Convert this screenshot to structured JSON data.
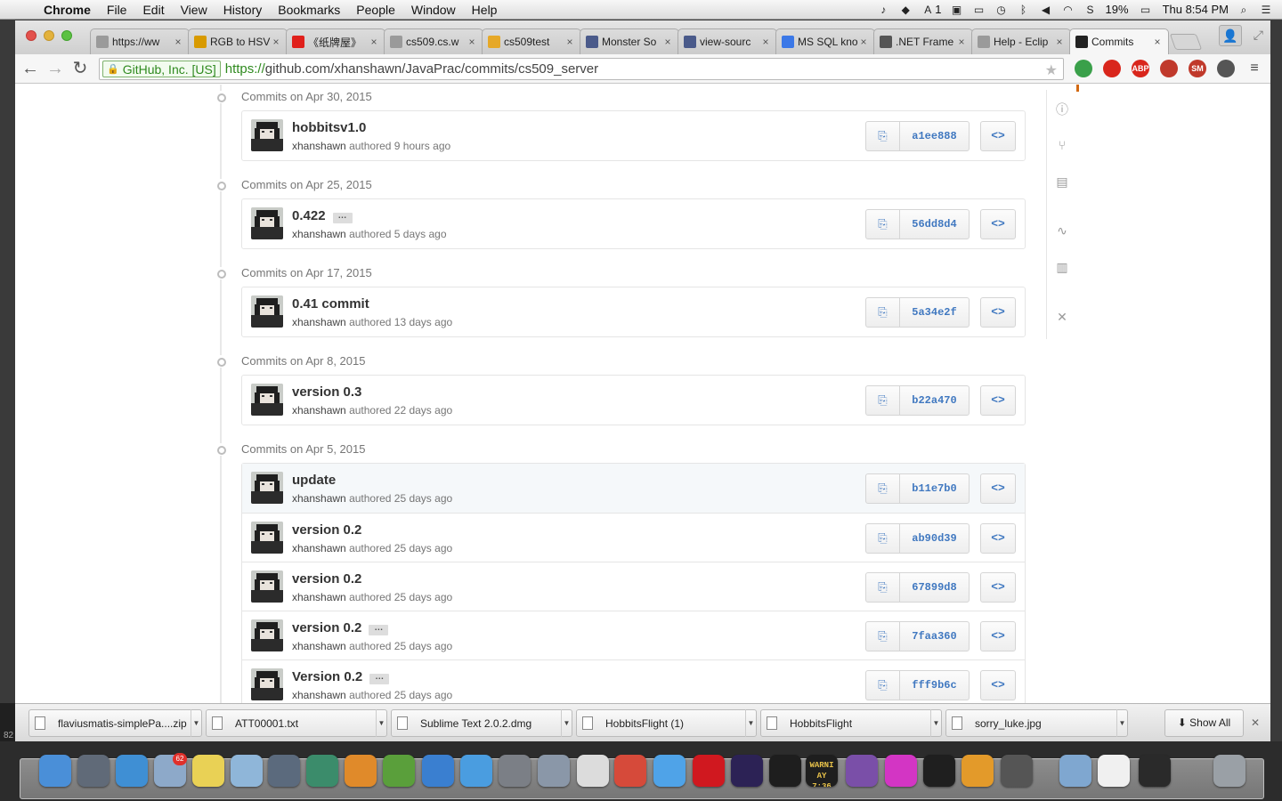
{
  "menubar": {
    "app": "Chrome",
    "items": [
      "File",
      "Edit",
      "View",
      "History",
      "Bookmarks",
      "People",
      "Window",
      "Help"
    ],
    "ai_count": "1",
    "battery": "19%",
    "clock": "Thu 8:54 PM"
  },
  "tabs": [
    {
      "title": "https://ww",
      "icon": "page-icon",
      "color": "#9a9a9a"
    },
    {
      "title": "RGB to HSV",
      "icon": "r-logo-icon",
      "color": "#d89a00"
    },
    {
      "title": "《纸牌屋》",
      "icon": "video-icon",
      "color": "#e0201b"
    },
    {
      "title": "cs509.cs.w",
      "icon": "page-icon",
      "color": "#9a9a9a"
    },
    {
      "title": "cs509test",
      "icon": "box-icon",
      "color": "#e6a828"
    },
    {
      "title": "Monster So",
      "icon": "hackerrank-icon",
      "color": "#4a5a8a"
    },
    {
      "title": "view-sourc",
      "icon": "hackerrank-icon",
      "color": "#4a5a8a"
    },
    {
      "title": "MS SQL kno",
      "icon": "google-icon",
      "color": "#3b78e7"
    },
    {
      "title": ".NET Frame",
      "icon": "wikipedia-icon",
      "color": "#555555"
    },
    {
      "title": "Help - Eclip",
      "icon": "page-icon",
      "color": "#9a9a9a"
    },
    {
      "title": "Commits",
      "icon": "github-icon",
      "color": "#222222"
    }
  ],
  "address": {
    "ev_name": "GitHub, Inc. [US]",
    "scheme": "https://",
    "url_rest": "github.com/xhanshawn/JavaPrac/commits/cs509_server"
  },
  "extensions": [
    {
      "name": "color-wheel-icon",
      "label": "",
      "color": "#3aa04a"
    },
    {
      "name": "stop-icon",
      "label": "",
      "color": "#d9261c"
    },
    {
      "name": "adblock-icon",
      "label": "ABP",
      "color": "#d9261c"
    },
    {
      "name": "book-icon",
      "label": "",
      "color": "#c0392b"
    },
    {
      "name": "sm-icon",
      "label": "SM",
      "color": "#c0392b"
    },
    {
      "name": "ball-icon",
      "label": "",
      "color": "#555555"
    },
    {
      "name": "menu-icon",
      "label": "",
      "color": "#777777"
    }
  ],
  "commit_days": [
    {
      "date": "Commits on Apr 30, 2015",
      "commits": [
        {
          "message": "hobbitsv1.0",
          "author": "xhanshawn",
          "verb": "authored",
          "time": "9 hours ago",
          "sha": "a1ee888",
          "ellipsis": false,
          "highlight": false
        }
      ]
    },
    {
      "date": "Commits on Apr 25, 2015",
      "commits": [
        {
          "message": "0.422",
          "author": "xhanshawn",
          "verb": "authored",
          "time": "5 days ago",
          "sha": "56dd8d4",
          "ellipsis": true,
          "highlight": false
        }
      ]
    },
    {
      "date": "Commits on Apr 17, 2015",
      "commits": [
        {
          "message": "0.41 commit",
          "author": "xhanshawn",
          "verb": "authored",
          "time": "13 days ago",
          "sha": "5a34e2f",
          "ellipsis": false,
          "highlight": false
        }
      ]
    },
    {
      "date": "Commits on Apr 8, 2015",
      "commits": [
        {
          "message": "version 0.3",
          "author": "xhanshawn",
          "verb": "authored",
          "time": "22 days ago",
          "sha": "b22a470",
          "ellipsis": false,
          "highlight": false
        }
      ]
    },
    {
      "date": "Commits on Apr 5, 2015",
      "commits": [
        {
          "message": "update",
          "author": "xhanshawn",
          "verb": "authored",
          "time": "25 days ago",
          "sha": "b11e7b0",
          "ellipsis": false,
          "highlight": true
        },
        {
          "message": "version 0.2",
          "author": "xhanshawn",
          "verb": "authored",
          "time": "25 days ago",
          "sha": "ab90d39",
          "ellipsis": false,
          "highlight": false
        },
        {
          "message": "version 0.2",
          "author": "xhanshawn",
          "verb": "authored",
          "time": "25 days ago",
          "sha": "67899d8",
          "ellipsis": false,
          "highlight": false
        },
        {
          "message": "version 0.2",
          "author": "xhanshawn",
          "verb": "authored",
          "time": "25 days ago",
          "sha": "7faa360",
          "ellipsis": true,
          "highlight": false
        },
        {
          "message": "Version 0.2",
          "author": "xhanshawn",
          "verb": "authored",
          "time": "25 days ago",
          "sha": "fff9b6c",
          "ellipsis": true,
          "highlight": false
        }
      ]
    }
  ],
  "repo_nav_icons": [
    "issues-icon",
    "pull-requests-icon",
    "wiki-icon",
    "pulse-icon",
    "graphs-icon",
    "settings-icon"
  ],
  "downloads": [
    {
      "name": "flaviusmatis-simplePa....zip"
    },
    {
      "name": "ATT00001.txt"
    },
    {
      "name": "Sublime Text 2.0.2.dmg"
    },
    {
      "name": "HobbitsFlight (1)"
    },
    {
      "name": "HobbitsFlight"
    },
    {
      "name": "sorry_luke.jpg"
    }
  ],
  "show_all": "Show All",
  "left_strip_text": "82",
  "dock": {
    "mail_badge": "62",
    "warning_text": "WARNI",
    "warning_time": "AY 7:36",
    "items": [
      {
        "name": "finder-icon",
        "color": "#4a8fd8"
      },
      {
        "name": "launchpad-icon",
        "color": "#606a78"
      },
      {
        "name": "safari-icon",
        "color": "#3f8fd4"
      },
      {
        "name": "mail-icon",
        "color": "#8da9c9"
      },
      {
        "name": "stickies-icon",
        "color": "#e9d155"
      },
      {
        "name": "preview-icon",
        "color": "#8fb6d9"
      },
      {
        "name": "facetime-icon",
        "color": "#5b6a7d"
      },
      {
        "name": "iphoto-icon",
        "color": "#3b8c6b"
      },
      {
        "name": "pages-icon",
        "color": "#e08a2a"
      },
      {
        "name": "numbers-icon",
        "color": "#5a9f3b"
      },
      {
        "name": "keynote-icon",
        "color": "#3a7fd0"
      },
      {
        "name": "itunes-icon",
        "color": "#4a9de0"
      },
      {
        "name": "system-prefs-icon",
        "color": "#7b7f86"
      },
      {
        "name": "image-capture-icon",
        "color": "#8a97a8"
      },
      {
        "name": "textedit-icon",
        "color": "#dcdcdc"
      },
      {
        "name": "chrome-icon",
        "color": "#d64a3a"
      },
      {
        "name": "messages-icon",
        "color": "#4fa3e8"
      },
      {
        "name": "netease-music-icon",
        "color": "#d0181f"
      },
      {
        "name": "eclipse-icon",
        "color": "#2c2255"
      },
      {
        "name": "terminal-icon",
        "color": "#1e1e1e"
      },
      {
        "name": "console-icon",
        "color": "#1e1e1e"
      },
      {
        "name": "github-app-icon",
        "color": "#7a4fa8"
      },
      {
        "name": "flower-icon",
        "color": "#d335c4"
      },
      {
        "name": "qq-icon",
        "color": "#1f1f1f"
      },
      {
        "name": "ampersand-icon",
        "color": "#e39a2a"
      },
      {
        "name": "sublime-icon",
        "color": "#555555"
      },
      {
        "name": "folder-icon",
        "color": "#7fa7d0"
      },
      {
        "name": "doc-icon",
        "color": "#f0f0f0"
      },
      {
        "name": "terminal-window-icon",
        "color": "#2a2a2a"
      },
      {
        "name": "trash-icon",
        "color": "#9aa0a6"
      }
    ]
  }
}
